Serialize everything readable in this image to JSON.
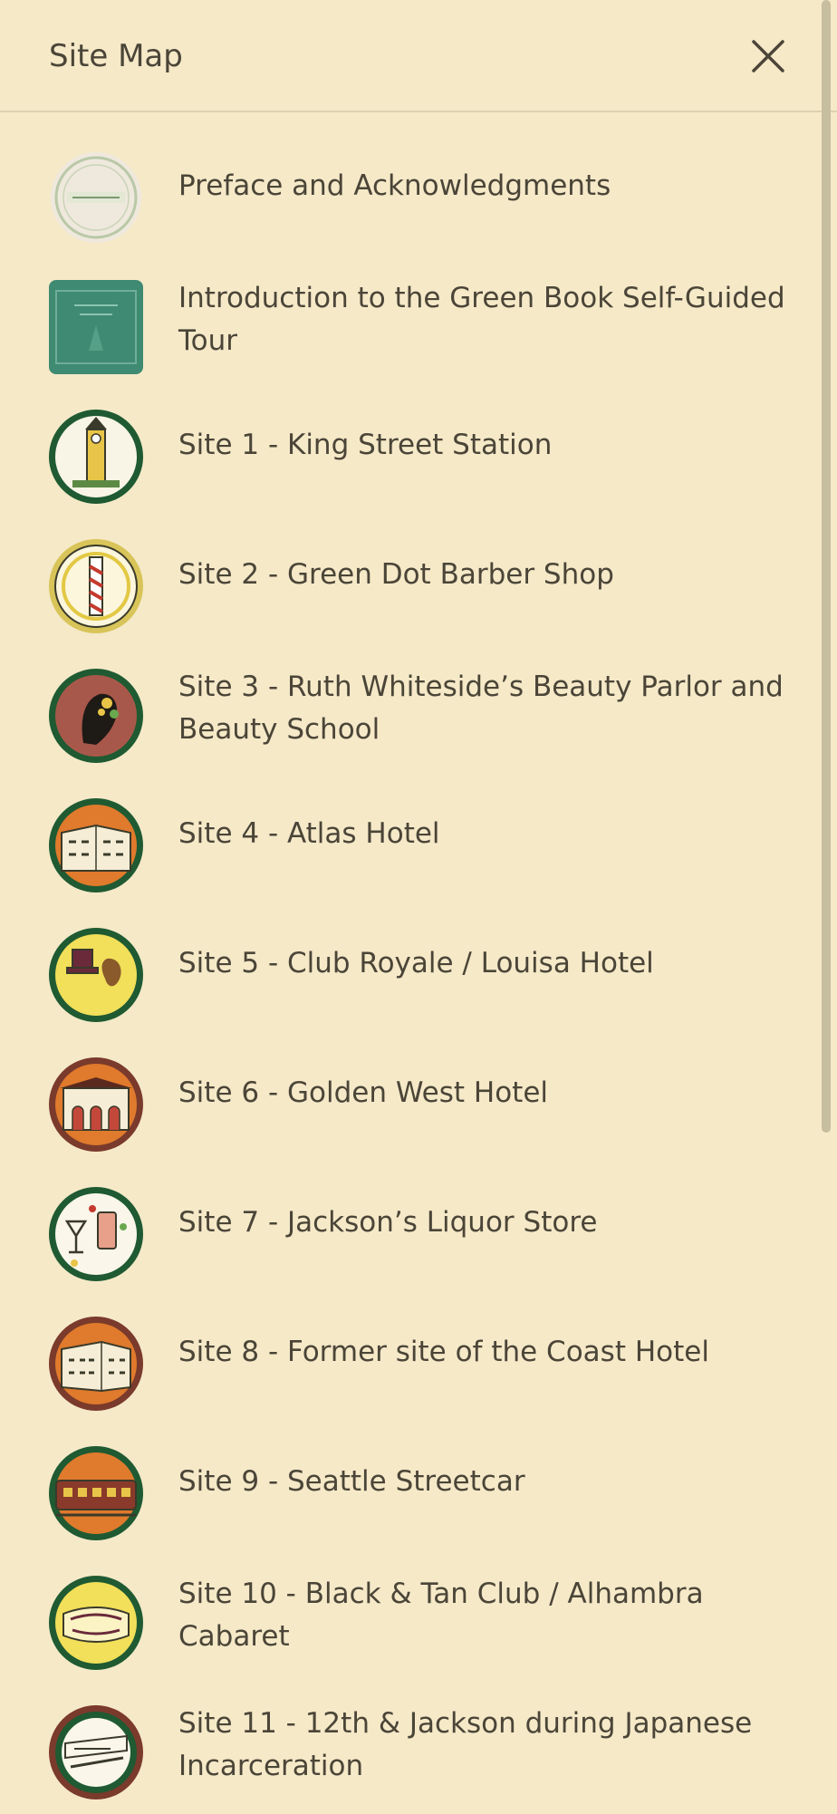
{
  "header": {
    "title": "Site Map",
    "close_icon": "close-icon"
  },
  "items": [
    {
      "label": "Preface and Acknowledgments",
      "icon": "green-book-seal-icon"
    },
    {
      "label": "Introduction to the Green Book Self-Guided Tour",
      "icon": "green-book-cover-icon"
    },
    {
      "label": "Site 1 - King Street Station",
      "icon": "clock-tower-icon"
    },
    {
      "label": "Site 2 - Green Dot Barber Shop",
      "icon": "barber-pole-icon"
    },
    {
      "label": "Site 3 - Ruth Whiteside’s Beauty Parlor and Beauty School",
      "icon": "woman-profile-icon"
    },
    {
      "label": "Site 4 - Atlas Hotel",
      "icon": "hotel-building-icon"
    },
    {
      "label": "Site 5 - Club Royale / Louisa Hotel",
      "icon": "top-hat-icon"
    },
    {
      "label": "Site 6 - Golden West Hotel",
      "icon": "arched-building-icon"
    },
    {
      "label": "Site 7 - Jackson’s Liquor Store",
      "icon": "cocktail-glasses-icon"
    },
    {
      "label": "Site 8 - Former site of the Coast Hotel",
      "icon": "corner-building-icon"
    },
    {
      "label": "Site 9 - Seattle Streetcar",
      "icon": "streetcar-icon"
    },
    {
      "label": "Site 10 - Black & Tan Club / Alhambra Cabaret",
      "icon": "cabaret-sign-icon"
    },
    {
      "label": "Site 11 - 12th & Jackson during Japanese Incarceration",
      "icon": "street-sign-icon"
    }
  ],
  "colors": {
    "background": "#f5e9c8",
    "text": "#4b4538",
    "seal_green": "#1f5a32",
    "seal_orange": "#d8742c",
    "seal_yellow": "#f0dc6a",
    "seal_maroon": "#7a3a2c"
  }
}
